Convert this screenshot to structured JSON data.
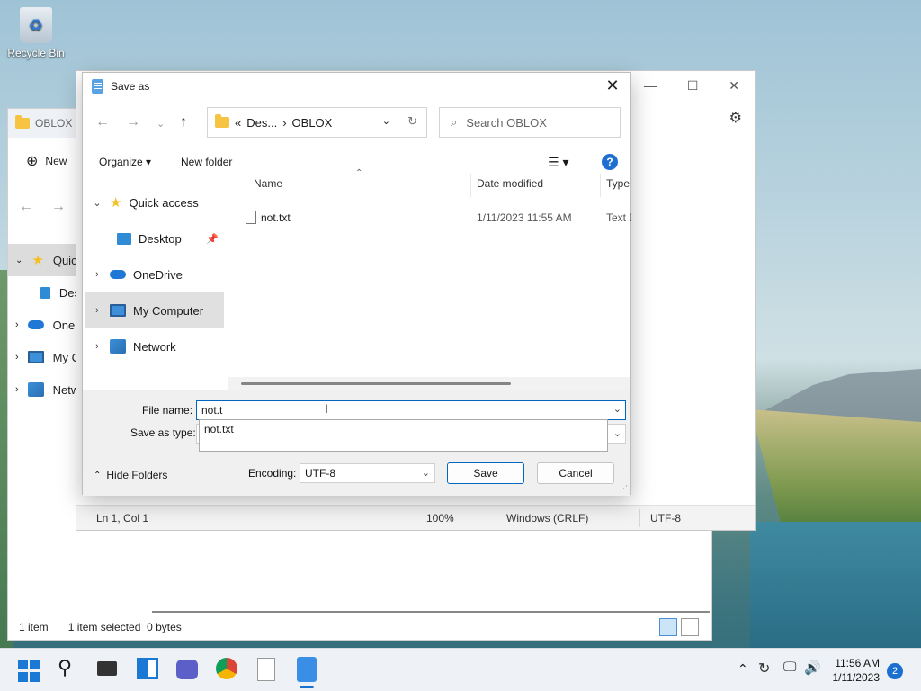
{
  "desktop": {
    "recycle_bin_label": "Recycle Bin"
  },
  "explorer": {
    "title": "OBLOX",
    "new_label": "New",
    "sidebar": [
      "Quic",
      "Des",
      "OneI",
      "My C",
      "Netw"
    ],
    "status_items": "1 item",
    "status_selected": "1 item selected",
    "status_size": "0 bytes"
  },
  "notepad": {
    "status": {
      "position": "Ln 1, Col 1",
      "zoom": "100%",
      "line_ending": "Windows (CRLF)",
      "encoding": "UTF-8"
    },
    "window_controls": {
      "minimize": "—",
      "maximize": "☐",
      "close": "✕"
    }
  },
  "dialog": {
    "title": "Save as",
    "breadcrumb": {
      "prefix": "«",
      "parent": "Des...",
      "separator": "›",
      "current": "OBLOX"
    },
    "search_placeholder": "Search OBLOX",
    "toolbar": {
      "organize": "Organize",
      "new_folder": "New folder",
      "help": "?"
    },
    "tree": [
      {
        "label": "Quick access",
        "chevron": "⌄"
      },
      {
        "label": "Desktop"
      },
      {
        "label": "OneDrive",
        "chevron": "›"
      },
      {
        "label": "My Computer",
        "chevron": "›"
      },
      {
        "label": "Network",
        "chevron": "›"
      }
    ],
    "columns": {
      "name": "Name",
      "date": "Date modified",
      "type": "Type"
    },
    "files": [
      {
        "name": "not.txt",
        "date": "1/11/2023 11:55 AM",
        "type": "Text D"
      }
    ],
    "file_name_label": "File name:",
    "file_name_value": "not.t",
    "save_as_type_label": "Save as type:",
    "autocomplete": [
      "not.txt"
    ],
    "hide_folders": "Hide Folders",
    "encoding_label": "Encoding:",
    "encoding_value": "UTF-8",
    "save_label": "Save",
    "cancel_label": "Cancel"
  },
  "taskbar": {
    "time": "11:56 AM",
    "date": "1/11/2023",
    "notifications": "2"
  },
  "colors": {
    "accent": "#0067c0",
    "folder": "#f6c342",
    "taskbar": "#eef1f5"
  }
}
